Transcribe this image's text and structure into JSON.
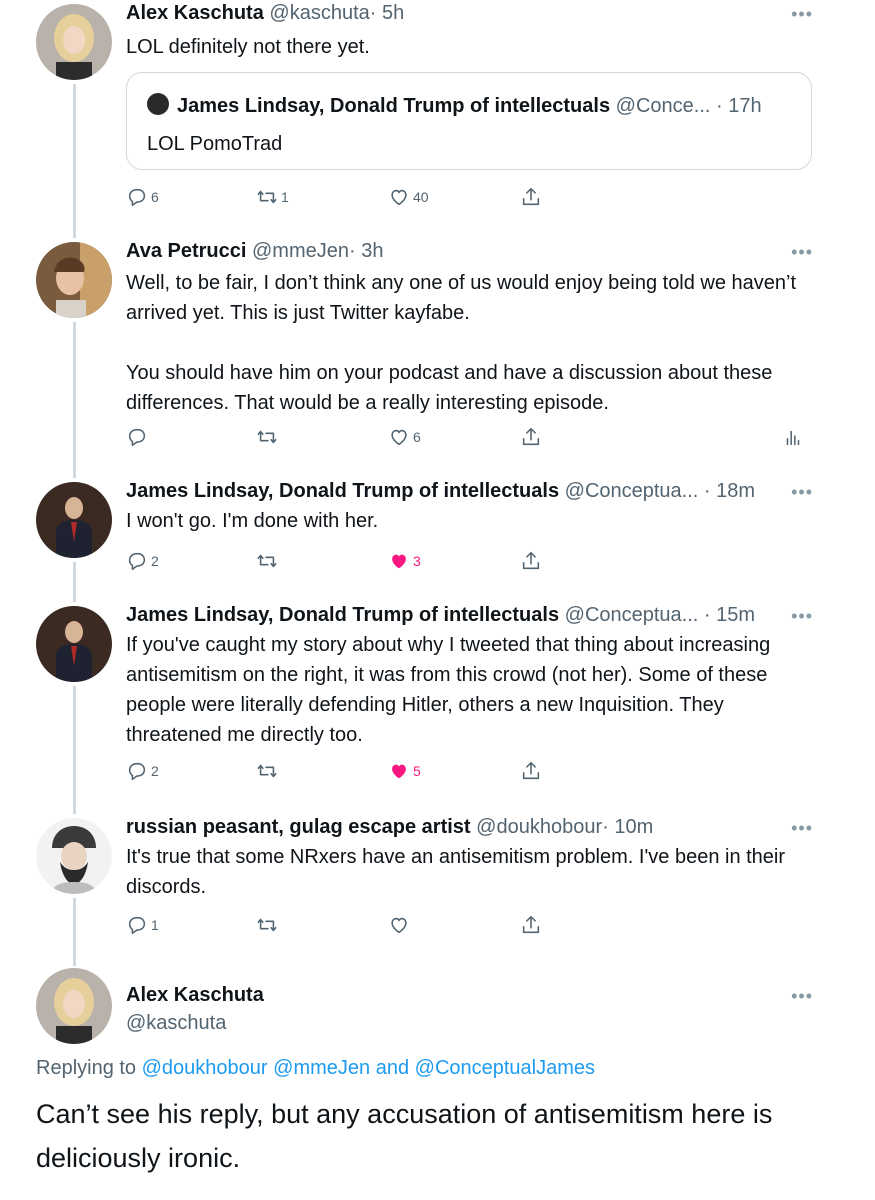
{
  "tweets": [
    {
      "name": "Alex Kaschuta",
      "handle": "@kaschuta",
      "time": "· 5h",
      "text": "LOL definitely not there yet.",
      "quote": {
        "name": "James Lindsay, Donald Trump of intellectuals",
        "handle": "@Conce...",
        "time": "· 17h",
        "text": "LOL PomoTrad"
      },
      "replies": "6",
      "retweets": "1",
      "likes": "40",
      "liked": false
    },
    {
      "name": "Ava Petrucci",
      "handle": "@mmeJen",
      "time": "· 3h",
      "text": "Well, to be fair, I don’t think any one of us would enjoy being told we haven’t arrived yet. This is just Twitter kayfabe.\n\nYou should have him on your podcast and have a discussion about these differences. That would be a really interesting episode.",
      "replies": "",
      "retweets": "",
      "likes": "6",
      "liked": false
    },
    {
      "name": "James Lindsay, Donald Trump of intellectuals",
      "handle": "@Conceptua...",
      "time": "· 18m",
      "text": "I won't go. I'm done with her.",
      "replies": "2",
      "retweets": "",
      "likes": "3",
      "liked": true
    },
    {
      "name": "James Lindsay, Donald Trump of intellectuals",
      "handle": "@Conceptua...",
      "time": "· 15m",
      "text": "If you've caught my story about why I tweeted that thing about increasing antisemitism on the right, it was from this crowd (not her). Some of these people were literally defending Hitler, others a new Inquisition. They threatened me directly too.",
      "replies": "2",
      "retweets": "",
      "likes": "5",
      "liked": true
    },
    {
      "name": "russian peasant, gulag escape artist",
      "handle": "@doukhobour",
      "time": "· 10m",
      "text": "It's true that some NRxers have an antisemitism problem. I've been in their discords.",
      "replies": "1",
      "retweets": "",
      "likes": "",
      "liked": false
    }
  ],
  "main_tweet": {
    "name": "Alex Kaschuta",
    "handle": "@kaschuta",
    "replying_label": "Replying to",
    "mention1": "@doukhobour",
    "mention2": "@mmeJen",
    "and_label": "and",
    "mention3": "@ConceptualJames",
    "text": "Can’t see his reply, but any accusation of antisemitism here is deliciously ironic."
  },
  "icons": {
    "reply": "reply-icon",
    "retweet": "retweet-icon",
    "like": "heart-icon",
    "share": "share-icon",
    "analytics": "analytics-icon",
    "more": "more-icon"
  },
  "colors": {
    "accent": "#1d9bf0",
    "like": "#f91880",
    "muted": "#536471",
    "thread": "#cfd9de"
  }
}
